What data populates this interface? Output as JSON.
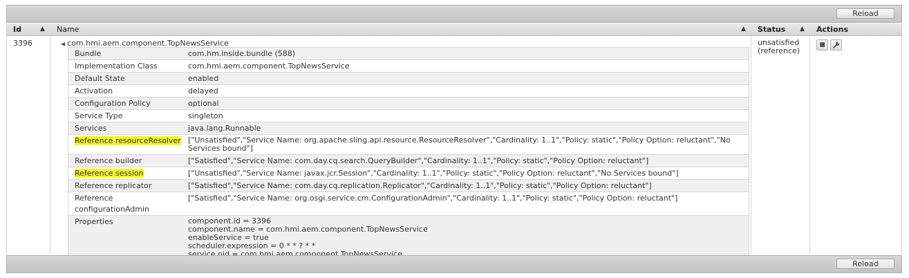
{
  "toolbar": {
    "reload_label": "Reload"
  },
  "columns": {
    "id": "Id",
    "name": "Name",
    "status": "Status",
    "actions": "Actions"
  },
  "component": {
    "id": "3396",
    "name": "com.hmi.aem.component.TopNewsService",
    "status": "unsatisfied (reference)",
    "action_icons": [
      "stop-icon",
      "configure-wrench-icon"
    ]
  },
  "details": [
    {
      "key": "Bundle",
      "value": "com.hm.inside.bundle (588)"
    },
    {
      "key": "Implementation Class",
      "value": "com.hmi.aem.component.TopNewsService"
    },
    {
      "key": "Default State",
      "value": "enabled"
    },
    {
      "key": "Activation",
      "value": "delayed"
    },
    {
      "key": "Configuration Policy",
      "value": "optional"
    },
    {
      "key": "Service Type",
      "value": "singleton"
    },
    {
      "key": "Services",
      "value": "java.lang.Runnable"
    },
    {
      "key": "Reference resourceResolver",
      "value": "[\"Unsatisfied\",\"Service Name: org.apache.sling.api.resource.ResourceResolver\",\"Cardinality: 1..1\",\"Policy: static\",\"Policy Option: reluctant\",\"No Services bound\"]"
    },
    {
      "key": "Reference builder",
      "value": "[\"Satisfied\",\"Service Name: com.day.cq.search.QueryBuilder\",\"Cardinality: 1..1\",\"Policy: static\",\"Policy Option: reluctant\"]"
    },
    {
      "key": "Reference session",
      "value": "[\"Unsatisfied\",\"Service Name: javax.jcr.Session\",\"Cardinality: 1..1\",\"Policy: static\",\"Policy Option: reluctant\",\"No Services bound\"]"
    },
    {
      "key": "Reference replicator",
      "value": "[\"Satisfied\",\"Service Name: com.day.cq.replication.Replicator\",\"Cardinality: 1..1\",\"Policy: static\",\"Policy Option: reluctant\"]"
    },
    {
      "key": "Reference configurationAdmin",
      "value": "[\"Satisfied\",\"Service Name: org.osgi.service.cm.ConfigurationAdmin\",\"Cardinality: 1..1\",\"Policy: static\",\"Policy Option: reluctant\"]"
    }
  ],
  "properties": {
    "key": "Properties",
    "lines": [
      "component.id = 3396",
      "component.name = com.hmi.aem.component.TopNewsService",
      "enableService = true",
      "scheduler.expression = 0 * * ? * *",
      "service.pid = com.hmi.aem.component.TopNewsService"
    ]
  },
  "highlight_color": "#f5f52a"
}
